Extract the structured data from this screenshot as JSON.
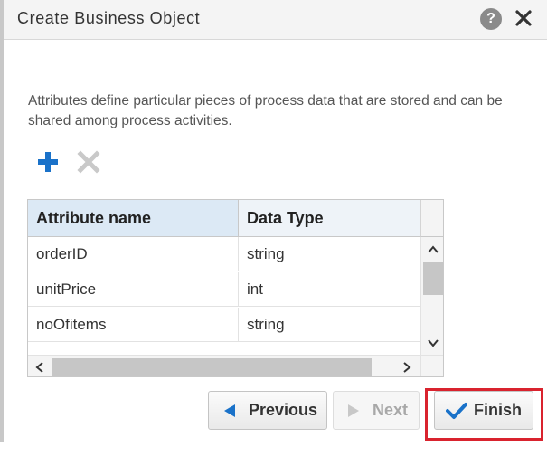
{
  "dialog": {
    "title": "Create Business Object",
    "help_label": "?",
    "description": "Attributes define particular pieces of process data that are stored and can be shared among process activities."
  },
  "toolbar": {
    "add_icon": "plus-icon",
    "delete_icon": "x-icon"
  },
  "grid": {
    "columns": [
      "Attribute name",
      "Data Type"
    ],
    "rows": [
      {
        "name": "orderID",
        "type": "string"
      },
      {
        "name": "unitPrice",
        "type": "int"
      },
      {
        "name": "noOfitems",
        "type": "string"
      }
    ]
  },
  "buttons": {
    "previous": "Previous",
    "next": "Next",
    "finish": "Finish"
  },
  "colors": {
    "accent_blue": "#1a72c9",
    "highlight_red": "#d9232e",
    "header_bg": "#dce9f5"
  }
}
